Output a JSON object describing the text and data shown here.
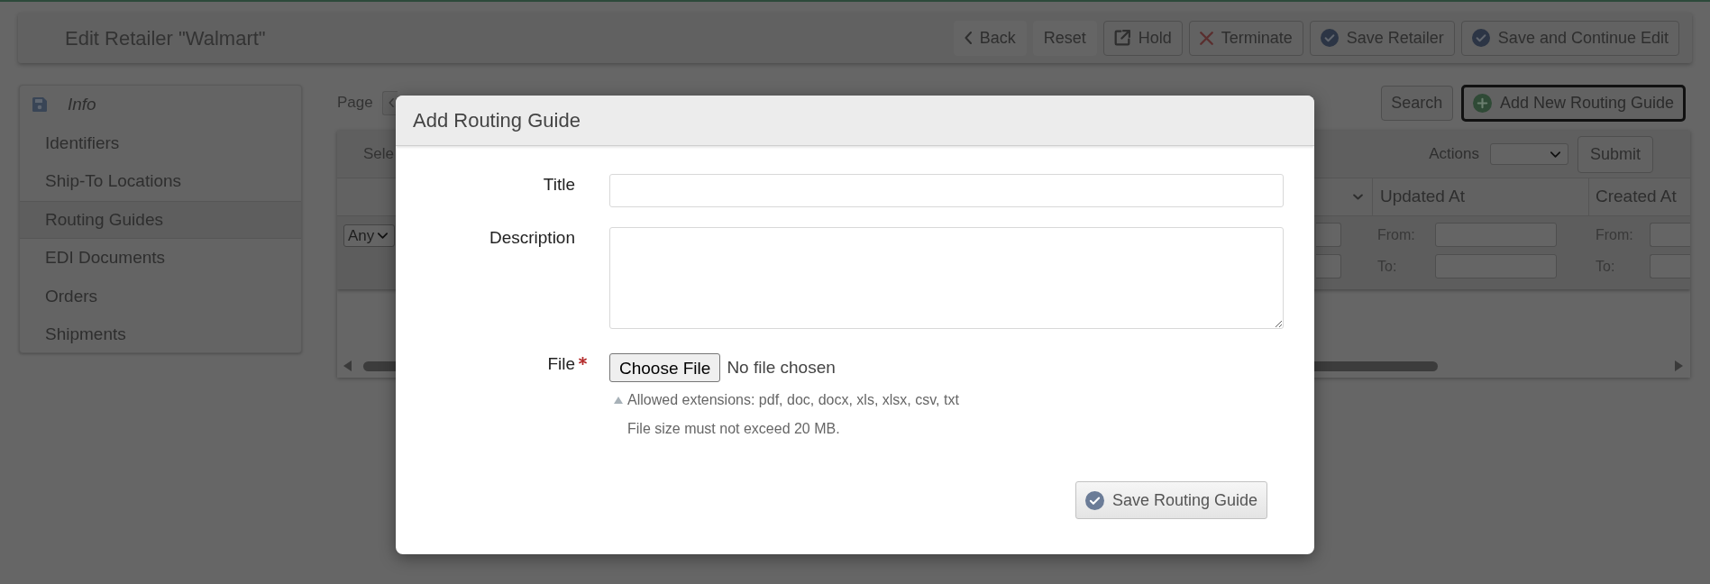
{
  "header": {
    "title": "Edit Retailer \"Walmart\"",
    "buttons": [
      {
        "label": "Back",
        "kind": "back"
      },
      {
        "label": "Reset",
        "kind": "plain"
      },
      {
        "label": "Hold",
        "kind": "external"
      },
      {
        "label": "Terminate",
        "kind": "cancel"
      },
      {
        "label": "Save Retailer",
        "kind": "confirm"
      },
      {
        "label": "Save and Continue Edit",
        "kind": "confirm"
      }
    ]
  },
  "sidebar": {
    "items": [
      {
        "label": "Info",
        "kind": "heading",
        "selected": false
      },
      {
        "label": "Identifiers",
        "kind": "link",
        "selected": false
      },
      {
        "label": "Ship-To Locations",
        "kind": "link",
        "selected": false
      },
      {
        "label": "Routing Guides",
        "kind": "link",
        "selected": true
      },
      {
        "label": "EDI Documents",
        "kind": "link",
        "selected": false
      },
      {
        "label": "Orders",
        "kind": "link",
        "selected": false
      },
      {
        "label": "Shipments",
        "kind": "link",
        "selected": false
      }
    ]
  },
  "toolbar": {
    "page_label": "Page",
    "search_button": "Search",
    "add_button": {
      "label": "Add New Routing Guide",
      "focused": true
    }
  },
  "table": {
    "select_label": "Sele",
    "actions_label": "Actions",
    "submit_button": "Submit",
    "status_filter": "Any",
    "columns": [
      {
        "label": "Updated At",
        "from_label": "From:",
        "to_label": "To:"
      },
      {
        "label": "Created At",
        "from_label": "From:",
        "to_label": "To:"
      }
    ]
  },
  "modal": {
    "title": "Add Routing Guide",
    "fields": [
      {
        "label": "Title",
        "kind": "text",
        "required": false
      },
      {
        "label": "Description",
        "kind": "textarea",
        "required": false
      },
      {
        "label": "File",
        "kind": "file",
        "required": true,
        "button": "Choose File",
        "value": "No file chosen",
        "hints": [
          "Allowed extensions: pdf, doc, docx, xls, xlsx, csv, txt",
          "File size must not exceed 20 MB."
        ]
      }
    ],
    "submit_button": "Save Routing Guide"
  }
}
